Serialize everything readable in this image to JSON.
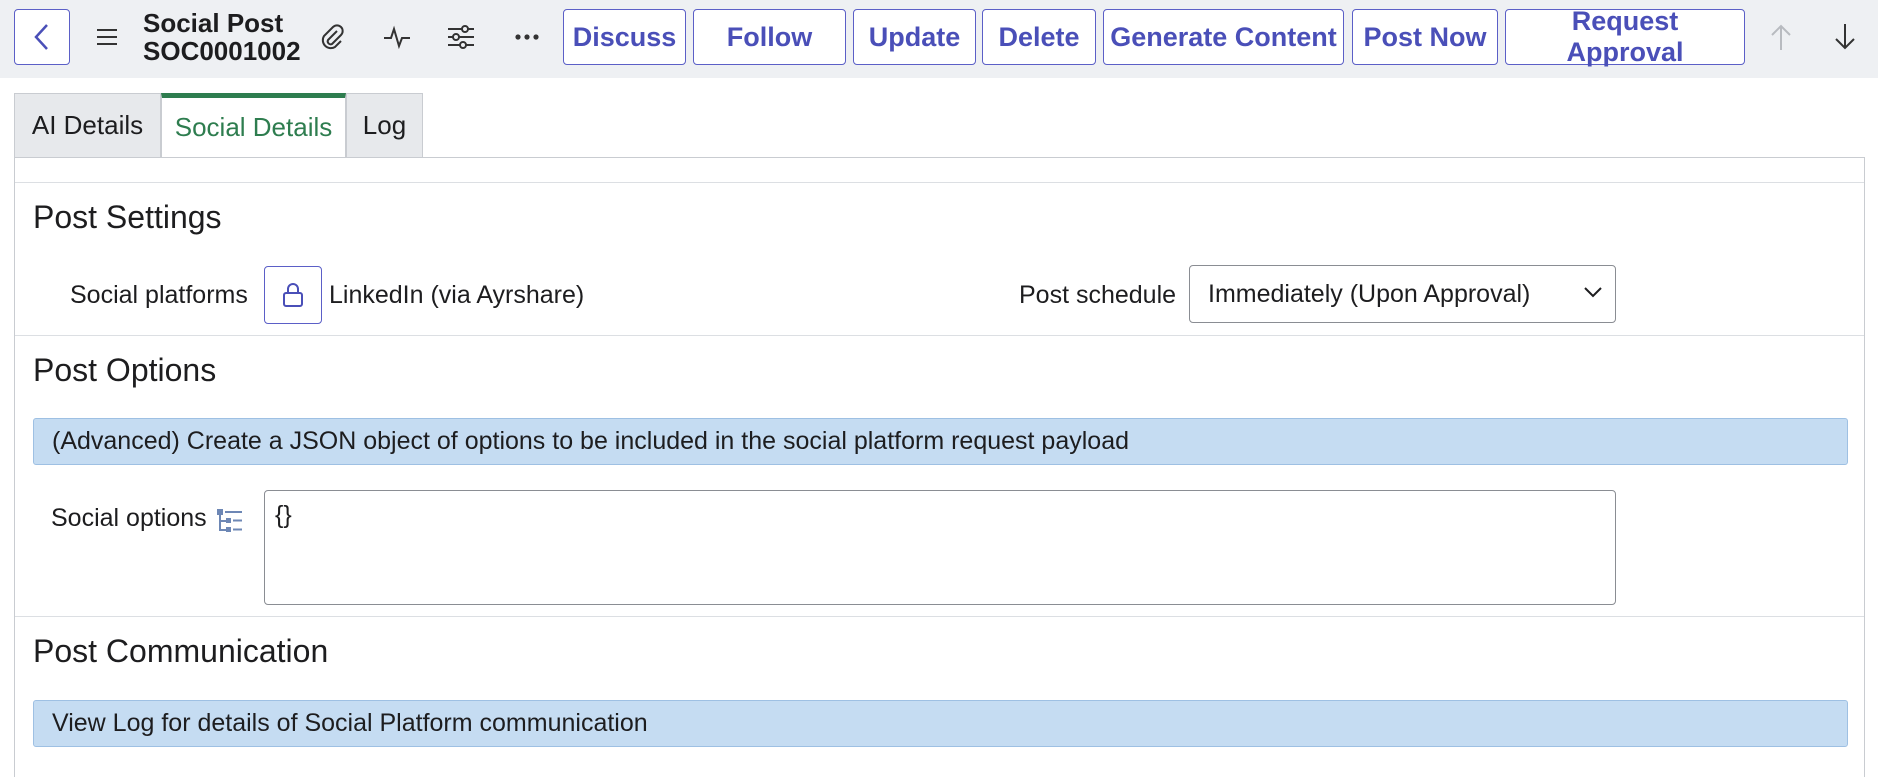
{
  "header": {
    "title_line1": "Social Post",
    "title_line2": "SOC0001002",
    "buttons": {
      "discuss": "Discuss",
      "follow": "Follow",
      "update": "Update",
      "delete": "Delete",
      "generate": "Generate Content",
      "post_now": "Post Now",
      "request_approval": "Request Approval"
    },
    "icons": [
      "back-icon",
      "menu-icon",
      "paperclip-icon",
      "activity-icon",
      "settings-sliders-icon",
      "more-icon",
      "arrow-up-icon",
      "arrow-down-icon"
    ]
  },
  "tabs": [
    {
      "label": "AI Details"
    },
    {
      "label": "Social Details"
    },
    {
      "label": "Log"
    }
  ],
  "active_tab": "Social Details",
  "post_settings": {
    "title": "Post Settings",
    "platforms_label": "Social platforms",
    "platforms_value": "LinkedIn (via Ayrshare)",
    "schedule_label": "Post schedule",
    "schedule_value": "Immediately (Upon Approval)"
  },
  "post_options": {
    "title": "Post Options",
    "info": "(Advanced) Create a JSON object of options to be included in the social platform request payload",
    "options_label": "Social options",
    "options_value": "{}"
  },
  "post_communication": {
    "title": "Post Communication",
    "info": "View Log for details of Social Platform communication"
  },
  "colors": {
    "accent": "#5b5fc7",
    "active_tab": "#2e7d4f",
    "info_bar": "#c5dcf2",
    "header_bg": "#eef0f3"
  }
}
